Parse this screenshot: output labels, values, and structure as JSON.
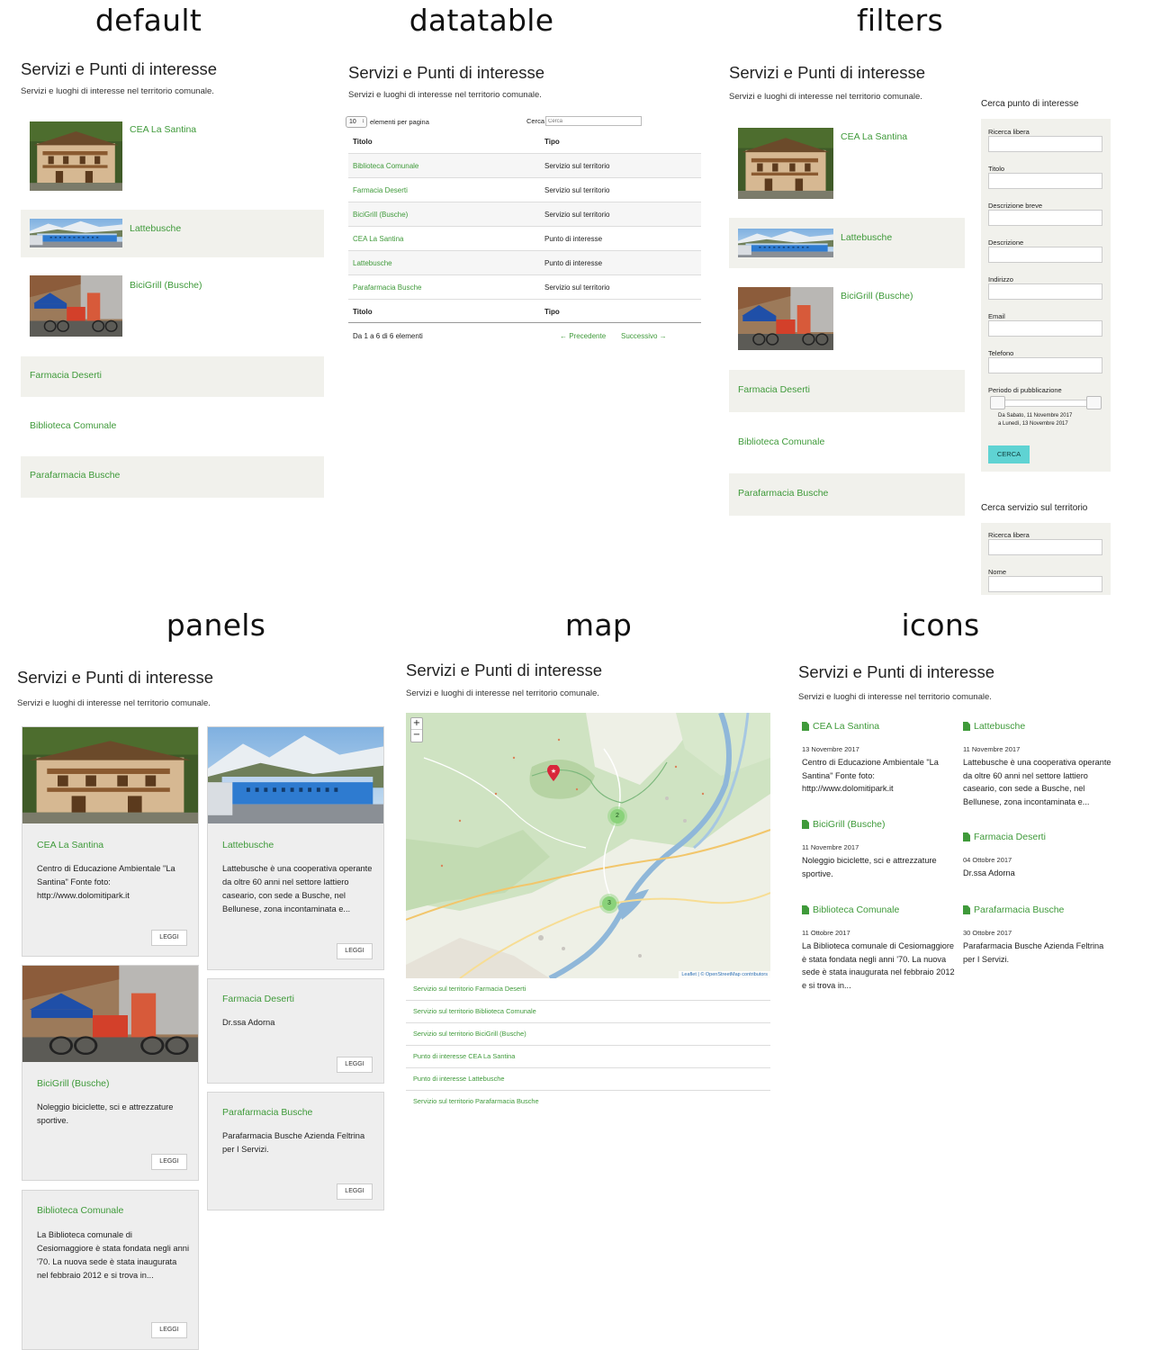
{
  "labels": {
    "default": "default",
    "datatable": "datatable",
    "filters": "filters",
    "panels": "panels",
    "map": "map",
    "icons": "icons"
  },
  "page": {
    "title": "Servizi e Punti di interesse",
    "description": "Servizi e luoghi di interesse nel territorio comunale."
  },
  "items": {
    "cea": "CEA La Santina",
    "latte": "Lattebusche",
    "bici": "BiciGrill (Busche)",
    "farmacia": "Farmacia Deserti",
    "biblioteca": "Biblioteca Comunale",
    "parafarmacia": "Parafarmacia Busche"
  },
  "datatable": {
    "page_size": "10",
    "page_size_label": "elementi per pagina",
    "search_label": "Cerca",
    "search_placeholder": "Cerca",
    "columns": [
      "Titolo",
      "Tipo"
    ],
    "rows": [
      [
        "Biblioteca Comunale",
        "Servizio sul territorio"
      ],
      [
        "Farmacia Deserti",
        "Servizio sul territorio"
      ],
      [
        "BiciGrill (Busche)",
        "Servizio sul territorio"
      ],
      [
        "CEA La Santina",
        "Punto di interesse"
      ],
      [
        "Lattebusche",
        "Punto di interesse"
      ],
      [
        "Parafarmacia Busche",
        "Servizio sul territorio"
      ]
    ],
    "info": "Da 1 a 6 di 6 elementi",
    "prev": "← Precedente",
    "next": "Successivo →"
  },
  "filters": {
    "poi_title": "Cerca punto di interesse",
    "poi_fields": [
      "Ricerca libera",
      "Titolo",
      "Descrizione breve",
      "Descrizione",
      "Indirizzo",
      "Email",
      "Telefono"
    ],
    "period_label": "Periodo di pubblicazione",
    "period_from": "Da Sabato, 11 Novembre 2017",
    "period_to": "a Lunedì, 13 Novembre 2017",
    "button": "CERCA",
    "service_title": "Cerca servizio sul territorio",
    "service_fields": [
      "Ricerca libera",
      "Nome"
    ]
  },
  "panels": {
    "leggi": "LEGGI",
    "cea_text": "Centro di Educazione Ambientale \"La Santina\" Fonte foto: http://www.dolomitipark.it",
    "latte_text": "Lattebusche è una cooperativa operante da oltre 60 anni nel settore lattiero caseario, con sede a Busche, nel Bellunese, zona incontaminata e...",
    "bici_text": "Noleggio biciclette, sci e attrezzature sportive.",
    "farmacia_text": "Dr.ssa Adorna",
    "biblioteca_text": "La Biblioteca comunale di Cesiomaggiore è stata fondata negli anni '70. La nuova sede è stata inaugurata nel febbraio 2012 e si trova in...",
    "parafarmacia_text": "Parafarmacia Busche Azienda Feltrina per I Servizi."
  },
  "map": {
    "zoom_in": "+",
    "zoom_out": "−",
    "cluster_a": "2",
    "cluster_b": "3",
    "attribution": "Leaflet | © OpenStreetMap contributors",
    "list": [
      "Servizio sul territorio Farmacia Deserti",
      "Servizio sul territorio Biblioteca Comunale",
      "Servizio sul territorio BiciGrill (Busche)",
      "Punto di interesse CEA La Santina",
      "Punto di interesse Lattebusche",
      "Servizio sul territorio Parafarmacia Busche"
    ]
  },
  "icons": {
    "cea_date": "13 Novembre 2017",
    "cea_text": "Centro di Educazione Ambientale \"La Santina\" Fonte foto: http://www.dolomitipark.it",
    "latte_date": "11 Novembre 2017",
    "latte_text": "Lattebusche è una cooperativa operante da oltre 60 anni nel settore lattiero caseario, con sede a Busche, nel Bellunese, zona incontaminata e...",
    "bici_date": "11 Novembre 2017",
    "bici_text": "Noleggio biciclette, sci e attrezzature sportive.",
    "farmacia_date": "04 Ottobre 2017",
    "farmacia_text": "Dr.ssa Adorna",
    "biblioteca_date": "11 Ottobre 2017",
    "biblioteca_text": "La Biblioteca comunale di Cesiomaggiore è stata fondata negli anni '70. La nuova sede è stata inaugurata nel febbraio 2012 e si trova in...",
    "parafarmacia_date": "30 Ottobre 2017",
    "parafarmacia_text": "Parafarmacia Busche Azienda Feltrina per I Servizi."
  },
  "colors": {
    "link": "#3f9a3a",
    "shade": "#f1f1ec",
    "button": "#5fd3d3",
    "panel": "#eeeeee"
  }
}
